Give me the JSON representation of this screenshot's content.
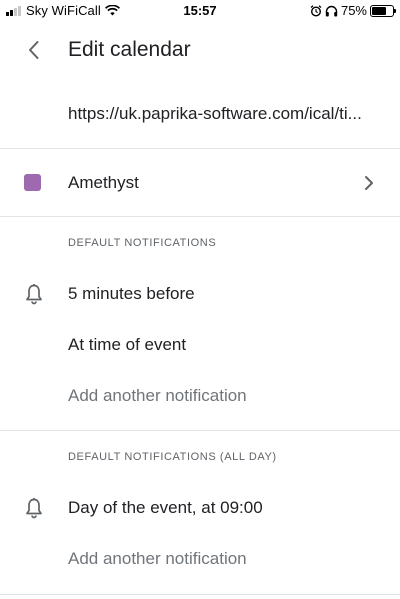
{
  "status_bar": {
    "carrier": "Sky WiFiCall",
    "time": "15:57",
    "battery_percent": "75%",
    "battery_level": 0.75,
    "signal_bars_on": 2,
    "signal_bars_total": 4
  },
  "header": {
    "title": "Edit calendar"
  },
  "calendar": {
    "url": "https://uk.paprika-software.com/ical/ti...",
    "color_name": "Amethyst",
    "color_hex": "#9e69af"
  },
  "default_notifications": {
    "header": "DEFAULT NOTIFICATIONS",
    "items": [
      "5 minutes before",
      "At time of event"
    ],
    "add_label": "Add another notification"
  },
  "all_day_notifications": {
    "header": "DEFAULT NOTIFICATIONS (ALL DAY)",
    "items": [
      "Day of the event, at 09:00"
    ],
    "add_label": "Add another notification"
  },
  "icons": {
    "back": "arrow-back-icon",
    "chevron": "chevron-right-icon",
    "bell": "bell-icon"
  },
  "colors": {
    "text_primary": "#202124",
    "text_secondary": "#5f6368",
    "divider": "#e3e3e3"
  }
}
